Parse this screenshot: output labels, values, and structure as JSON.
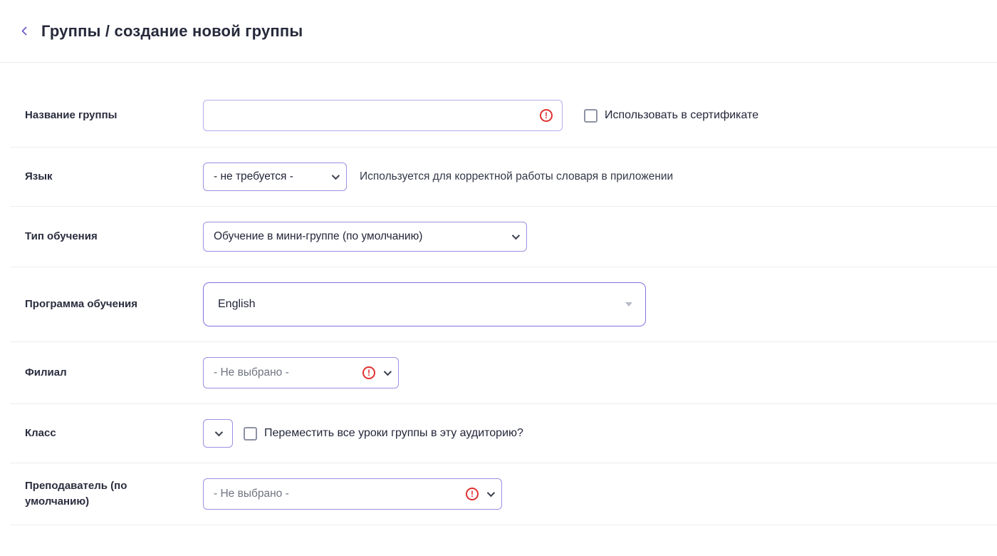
{
  "header": {
    "title": "Группы / создание новой группы"
  },
  "icons": {
    "warning_glyph": "!"
  },
  "form": {
    "group_name": {
      "label": "Название группы",
      "value": "",
      "certificate_checkbox_label": "Использовать в сертификате",
      "certificate_checkbox_checked": false
    },
    "language": {
      "label": "Язык",
      "selected": "- не требуется -",
      "hint": "Используется для корректной работы словаря в приложении"
    },
    "training_type": {
      "label": "Тип обучения",
      "selected": "Обучение в мини-группе (по умолчанию)"
    },
    "program": {
      "label": "Программа обучения",
      "selected": "English"
    },
    "branch": {
      "label": "Филиал",
      "selected": "- Не выбрано -"
    },
    "classroom": {
      "label": "Класс",
      "selected": "",
      "move_checkbox_label": "Переместить все уроки группы в эту аудиторию?",
      "move_checkbox_checked": false
    },
    "teacher": {
      "label": "Преподаватель (по умолчанию)",
      "selected": "- Не выбрано -"
    }
  },
  "colors": {
    "accent": "#6d5bd0",
    "error": "#e03131",
    "divider": "#ecedf1"
  }
}
